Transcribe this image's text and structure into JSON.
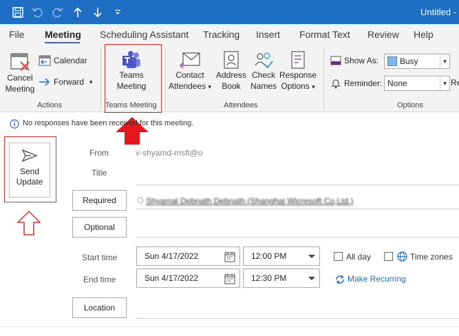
{
  "titlebar": {
    "title": "Untitled -",
    "icons": [
      "save-icon",
      "undo-icon",
      "redo-icon",
      "up-arrow-icon",
      "down-arrow-icon",
      "customize-icon"
    ]
  },
  "menu": {
    "tabs": [
      "File",
      "Meeting",
      "Scheduling Assistant",
      "Tracking",
      "Insert",
      "Format Text",
      "Review",
      "Help"
    ],
    "active": "Meeting"
  },
  "ribbon": {
    "cancel": [
      "Cancel",
      "Meeting"
    ],
    "calendar": "Calendar",
    "forward": "Forward",
    "actions_label": "Actions",
    "teams": [
      "Teams",
      "Meeting"
    ],
    "teams_label": "Teams Meeting",
    "contact": [
      "Contact",
      "Attendees"
    ],
    "address": [
      "Address",
      "Book"
    ],
    "check": [
      "Check",
      "Names"
    ],
    "response": [
      "Response",
      "Options"
    ],
    "attendees_label": "Attendees",
    "show_as_label": "Show As:",
    "show_as_value": "Busy",
    "reminder_label": "Reminder:",
    "reminder_value": "None",
    "recurrence_partial": "Re",
    "options_label": "Options"
  },
  "infobar": {
    "text": "No responses have been received for this meeting."
  },
  "form": {
    "send": [
      "Send",
      "Update"
    ],
    "from_label": "From",
    "from_value": "v-shyamd-msft@o",
    "title_label": "Title",
    "required_label": "Required",
    "required_value": "Shyamal Debnath Debnath (Shanghai Wicresoft Co,Ltd.)",
    "optional_label": "Optional",
    "start_label": "Start time",
    "start_date": "Sun 4/17/2022",
    "start_time": "12:00 PM",
    "end_label": "End time",
    "end_date": "Sun 4/17/2022",
    "end_time": "12:30 PM",
    "all_day": "All day",
    "time_zones": "Time zones",
    "make_recurring": "Make Recurring",
    "location_label": "Location"
  },
  "colors": {
    "accent": "#1e6fc4",
    "highlight": "#d9312b",
    "arrow_fill": "#e8161b"
  }
}
